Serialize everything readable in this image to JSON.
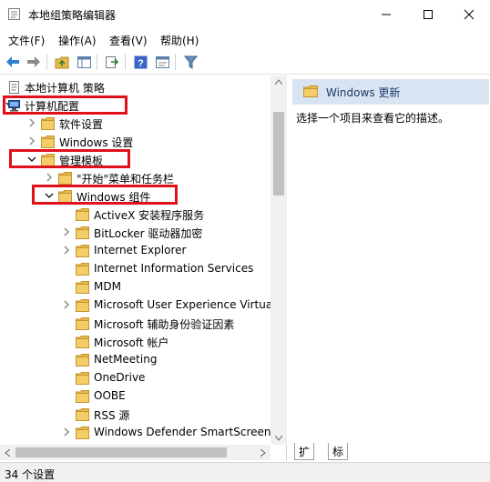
{
  "window": {
    "title": "本地组策略编辑器"
  },
  "menu": [
    "文件(F)",
    "操作(A)",
    "查看(V)",
    "帮助(H)"
  ],
  "toolbar": [
    "back-icon",
    "forward-icon",
    "up-folder-icon",
    "show-hide-tree-icon",
    "export-list-icon",
    "help-icon",
    "properties-icon",
    "filter-icon"
  ],
  "tree": [
    {
      "label": "本地计算机 策略",
      "level": 0,
      "icon": "policy-icon",
      "expander": "none"
    },
    {
      "label": "计算机配置",
      "level": 0,
      "icon": "computer-icon",
      "expander": "expanded",
      "highlighted": true
    },
    {
      "label": "软件设置",
      "level": 1,
      "icon": "folder-icon",
      "expander": "collapsed"
    },
    {
      "label": "Windows 设置",
      "level": 1,
      "icon": "folder-icon",
      "expander": "collapsed"
    },
    {
      "label": "管理模板",
      "level": 1,
      "icon": "folder-icon",
      "expander": "expanded",
      "highlighted": true
    },
    {
      "label": "\"开始\"菜单和任务栏",
      "level": 2,
      "icon": "folder-icon",
      "expander": "collapsed"
    },
    {
      "label": "Windows 组件",
      "level": 2,
      "icon": "folder-icon",
      "expander": "expanded",
      "highlighted": true
    },
    {
      "label": "ActiveX 安装程序服务",
      "level": 3,
      "icon": "folder-icon",
      "expander": "none"
    },
    {
      "label": "BitLocker 驱动器加密",
      "level": 3,
      "icon": "folder-icon",
      "expander": "collapsed"
    },
    {
      "label": "Internet Explorer",
      "level": 3,
      "icon": "folder-icon",
      "expander": "collapsed"
    },
    {
      "label": "Internet Information Services",
      "level": 3,
      "icon": "folder-icon",
      "expander": "none"
    },
    {
      "label": "MDM",
      "level": 3,
      "icon": "folder-icon",
      "expander": "none"
    },
    {
      "label": "Microsoft User Experience Virtual",
      "level": 3,
      "icon": "folder-icon",
      "expander": "collapsed"
    },
    {
      "label": "Microsoft 辅助身份验证因素",
      "level": 3,
      "icon": "folder-icon",
      "expander": "none"
    },
    {
      "label": "Microsoft 帐户",
      "level": 3,
      "icon": "folder-icon",
      "expander": "none"
    },
    {
      "label": "NetMeeting",
      "level": 3,
      "icon": "folder-icon",
      "expander": "none"
    },
    {
      "label": "OneDrive",
      "level": 3,
      "icon": "folder-icon",
      "expander": "none"
    },
    {
      "label": "OOBE",
      "level": 3,
      "icon": "folder-icon",
      "expander": "none"
    },
    {
      "label": "RSS 源",
      "level": 3,
      "icon": "folder-icon",
      "expander": "none"
    },
    {
      "label": "Windows Defender SmartScreen",
      "level": 3,
      "icon": "folder-icon",
      "expander": "collapsed"
    }
  ],
  "right_pane": {
    "header": "Windows 更新",
    "description": "选择一个项目来查看它的描述。",
    "tabs": [
      "扩展",
      "标准"
    ]
  },
  "status": "34 个设置",
  "colors": {
    "highlight": "#e0111b",
    "header_bg": "#d9e4f2",
    "folder": "#e8b84a"
  }
}
